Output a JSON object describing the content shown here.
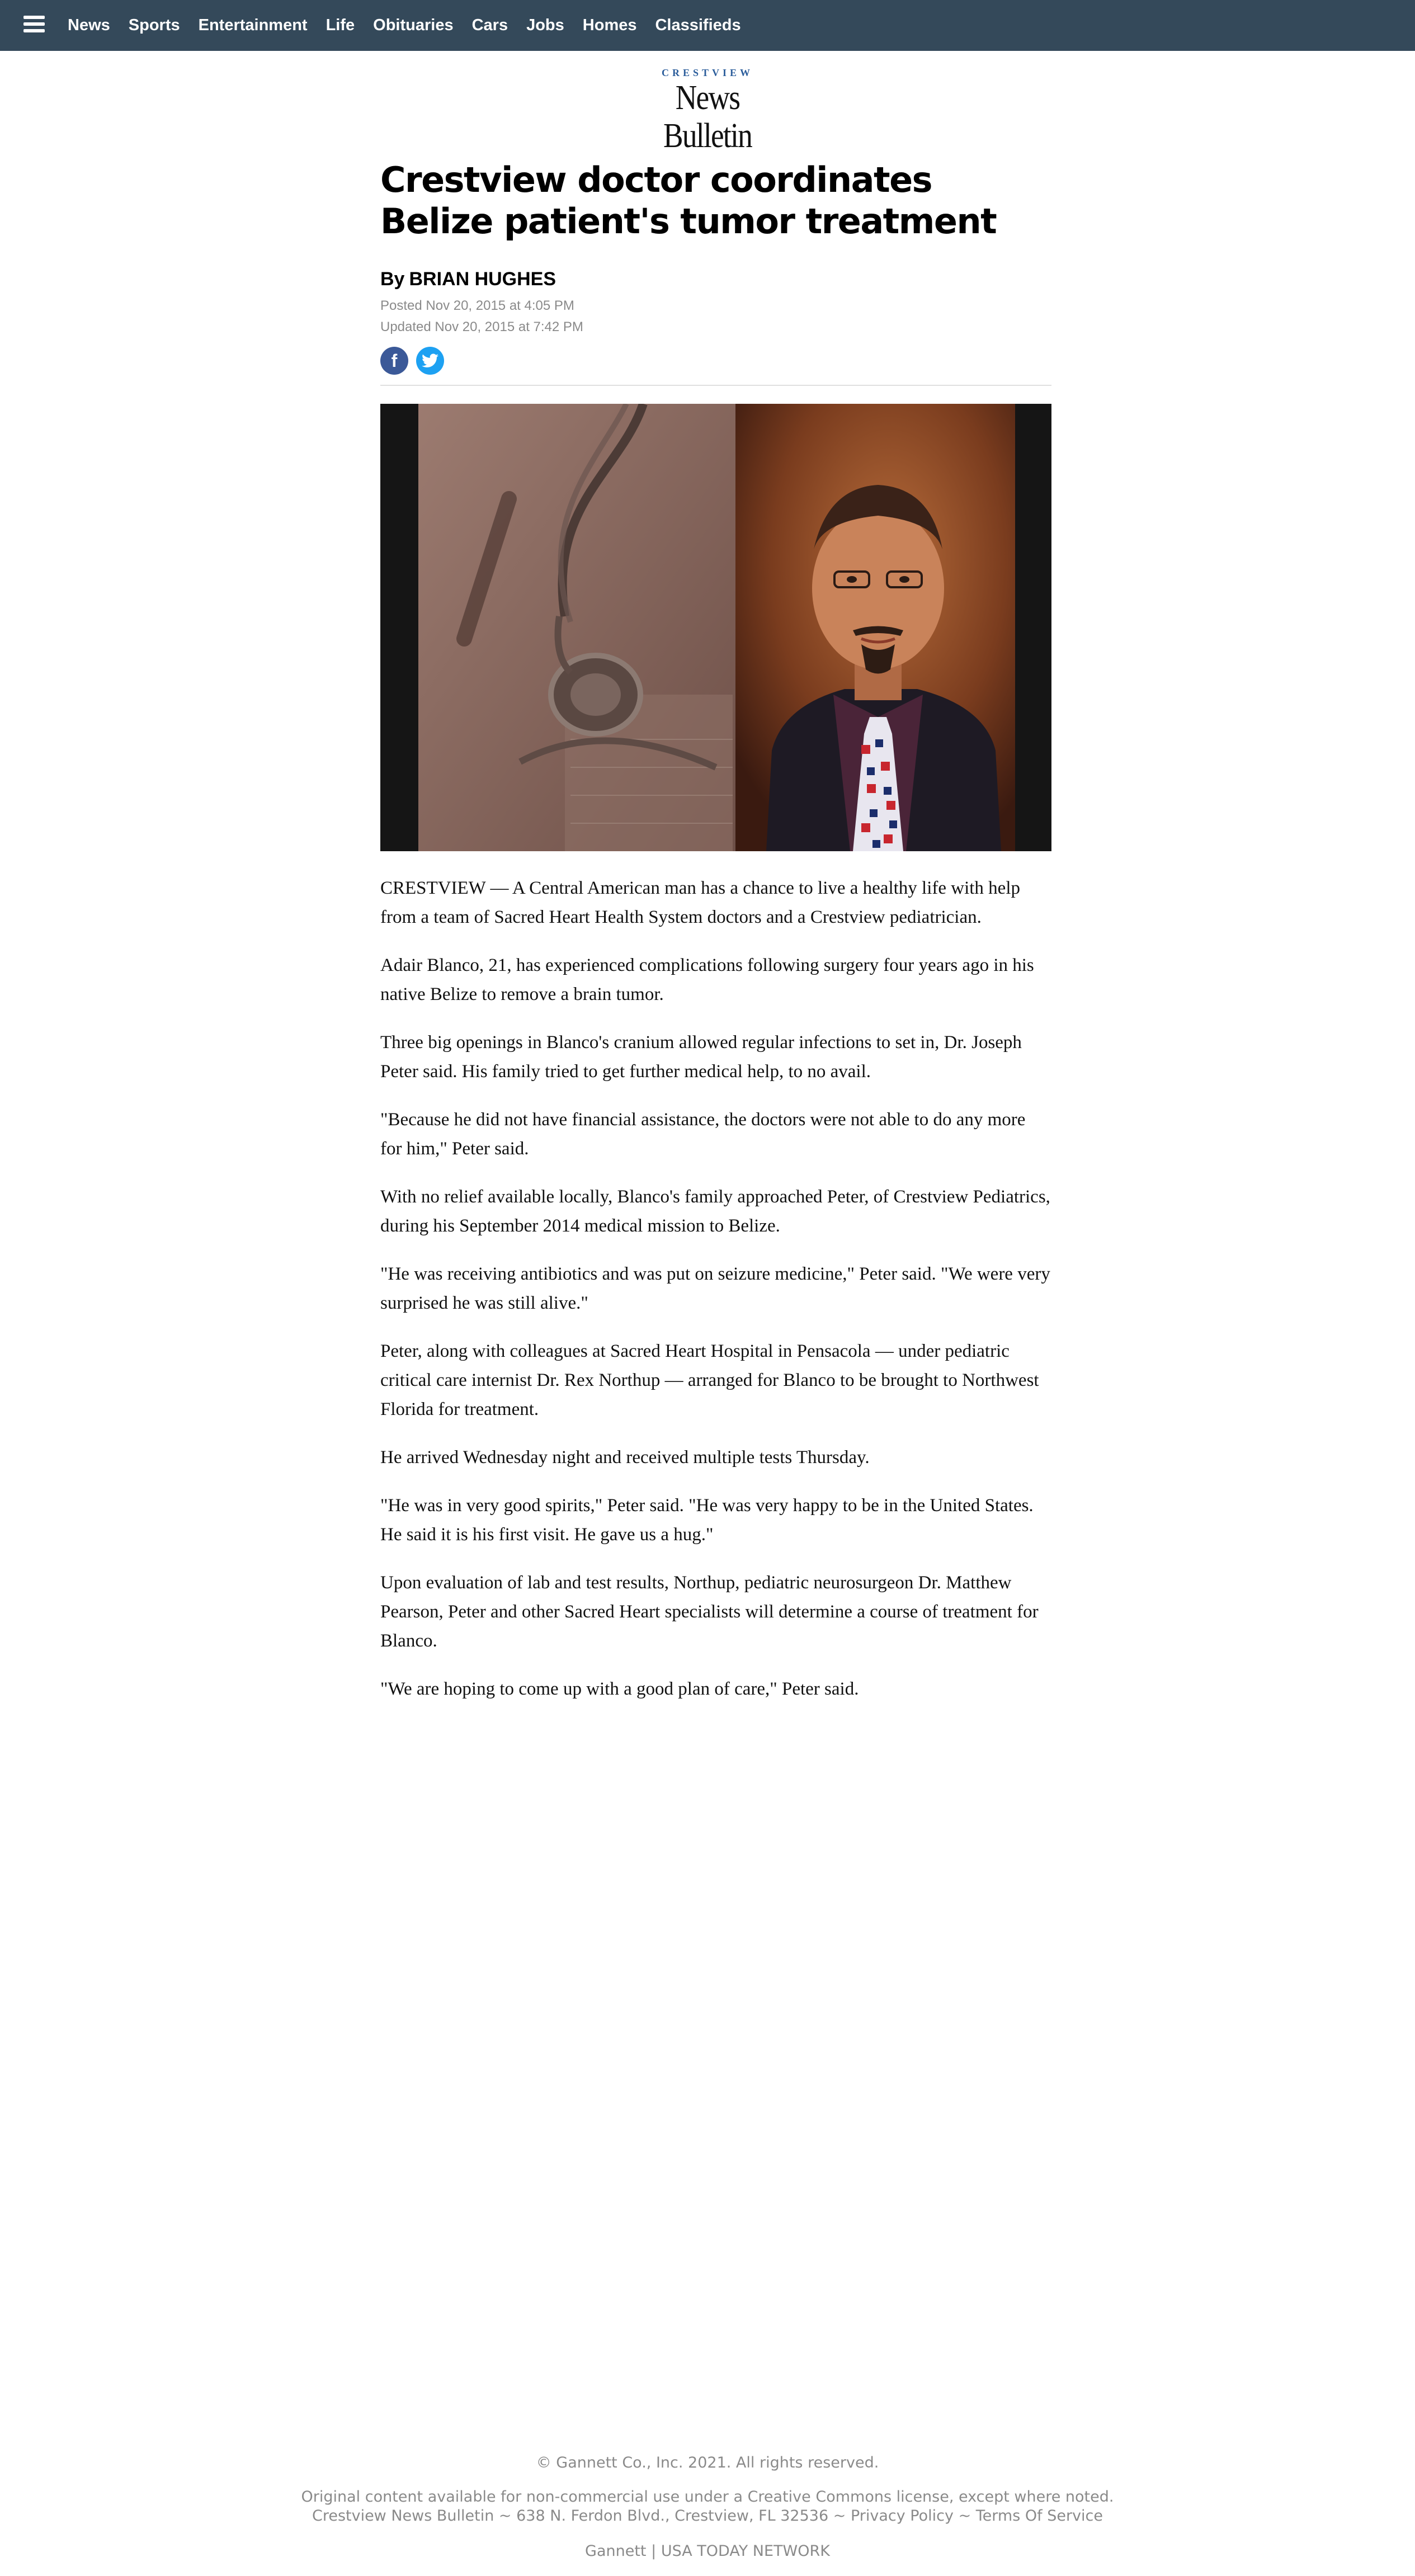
{
  "nav": {
    "items": [
      "News",
      "Sports",
      "Entertainment",
      "Life",
      "Obituaries",
      "Cars",
      "Jobs",
      "Homes",
      "Classifieds"
    ]
  },
  "logo": {
    "top": "CRESTVIEW",
    "main": "News Bulletin"
  },
  "article": {
    "headline": "Crestview doctor coordinates Belize patient's tumor treatment",
    "by_prefix": "By",
    "author": "BRIAN HUGHES",
    "posted": "Posted Nov 20, 2015 at 4:05 PM",
    "updated": "Updated Nov 20, 2015 at 7:42 PM",
    "paragraphs": [
      "CRESTVIEW — A Central American man has a chance to live a healthy life with help from a team of Sacred Heart Health System doctors and a Crestview pediatrician.",
      "Adair Blanco, 21, has experienced complications following surgery four years ago in his native Belize to remove a brain tumor.",
      "Three big openings in Blanco's cranium allowed regular infections to set in, Dr. Joseph Peter said. His family tried to get further medical help, to no avail.",
      "\"Because he did not have financial assistance, the doctors were not able to do any more for him,\" Peter said.",
      "With no relief available locally, Blanco's family approached Peter, of Crestview Pediatrics, during his September 2014 medical mission to Belize.",
      "\"He was receiving antibiotics and was put on seizure medicine,\" Peter said. \"We were very surprised he was still alive.\"",
      "Peter, along with colleagues at Sacred Heart Hospital in Pensacola — under pediatric critical care internist Dr. Rex Northup — arranged for Blanco to be brought to Northwest Florida for treatment.",
      "He arrived Wednesday night and received multiple tests Thursday.",
      "\"He was in very good spirits,\" Peter said. \"He was very happy to be in the United States. He said it is his first visit. He gave us a hug.\"",
      "Upon evaluation of lab and test results, Northup, pediatric neurosurgeon Dr. Matthew Pearson, Peter and other Sacred Heart specialists will determine a course of treatment for Blanco.",
      "\"We are hoping to come up with a good plan of care,\" Peter said."
    ]
  },
  "social": {
    "facebook_glyph": "f",
    "twitter_icon": "twitter-bird"
  },
  "footer": {
    "copyright": "© Gannett Co., Inc. 2021. All rights reserved.",
    "license": "Original content available for non-commercial use under a Creative Commons license, except where noted.",
    "address": "Crestview News Bulletin ~ 638 N. Ferdon Blvd., Crestview, FL 32536 ~",
    "privacy": "Privacy Policy",
    "sep": "~",
    "terms": "Terms Of Service",
    "gannett": "Gannett",
    "pipe": "|",
    "network": "USA TODAY NETWORK"
  }
}
